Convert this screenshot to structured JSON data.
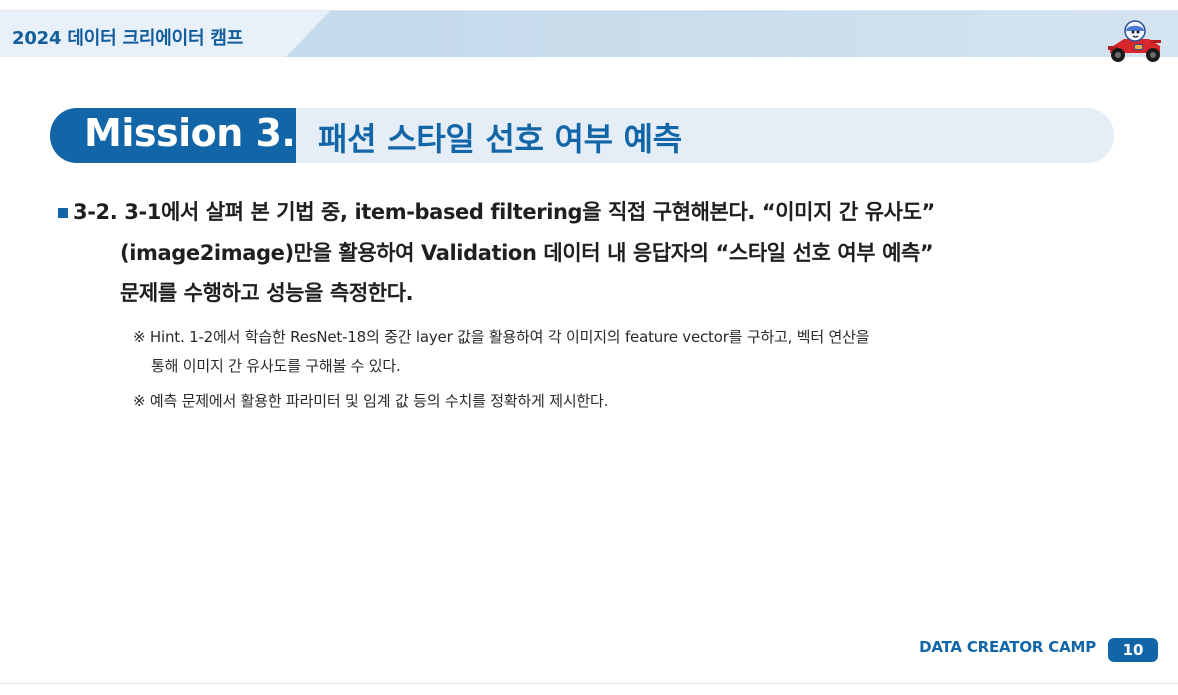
{
  "header": {
    "title": "2024 데이터 크리에이터 캠프"
  },
  "mission": {
    "label": "Mission 3.",
    "title": "패션 스타일 선호 여부 예측"
  },
  "content": {
    "main": [
      "3-2. 3-1에서 살펴 본 기법 중, item-based filtering을 직접 구현해본다. “이미지 간 유사도”",
      "(image2image)만을 활용하여 Validation 데이터 내 응답자의 “스타일 선호 여부 예측”",
      "문제를 수행하고 성능을 측정한다."
    ],
    "hints": [
      "※ Hint. 1-2에서 학습한 ResNet-18의 중간 layer 값을 활용하여 각 이미지의 feature vector를 구하고, 벡터 연산을",
      "통해 이미지 간 유사도를 구해볼 수 있다.",
      "※ 예측 문제에서 활용한 파라미터 및 임계 값 등의 수치를 정확하게 제시한다."
    ]
  },
  "footer": {
    "brand": "DATA CREATOR CAMP",
    "page": "10"
  },
  "colors": {
    "brand_blue": "#1266a8",
    "header_blue": "#c5daeb",
    "header_tab": "#e8f1fa",
    "mission_bg": "#e5eef7"
  },
  "icons": {
    "header": "race-car-mascot-icon",
    "bullet": "square-bullet-icon"
  }
}
